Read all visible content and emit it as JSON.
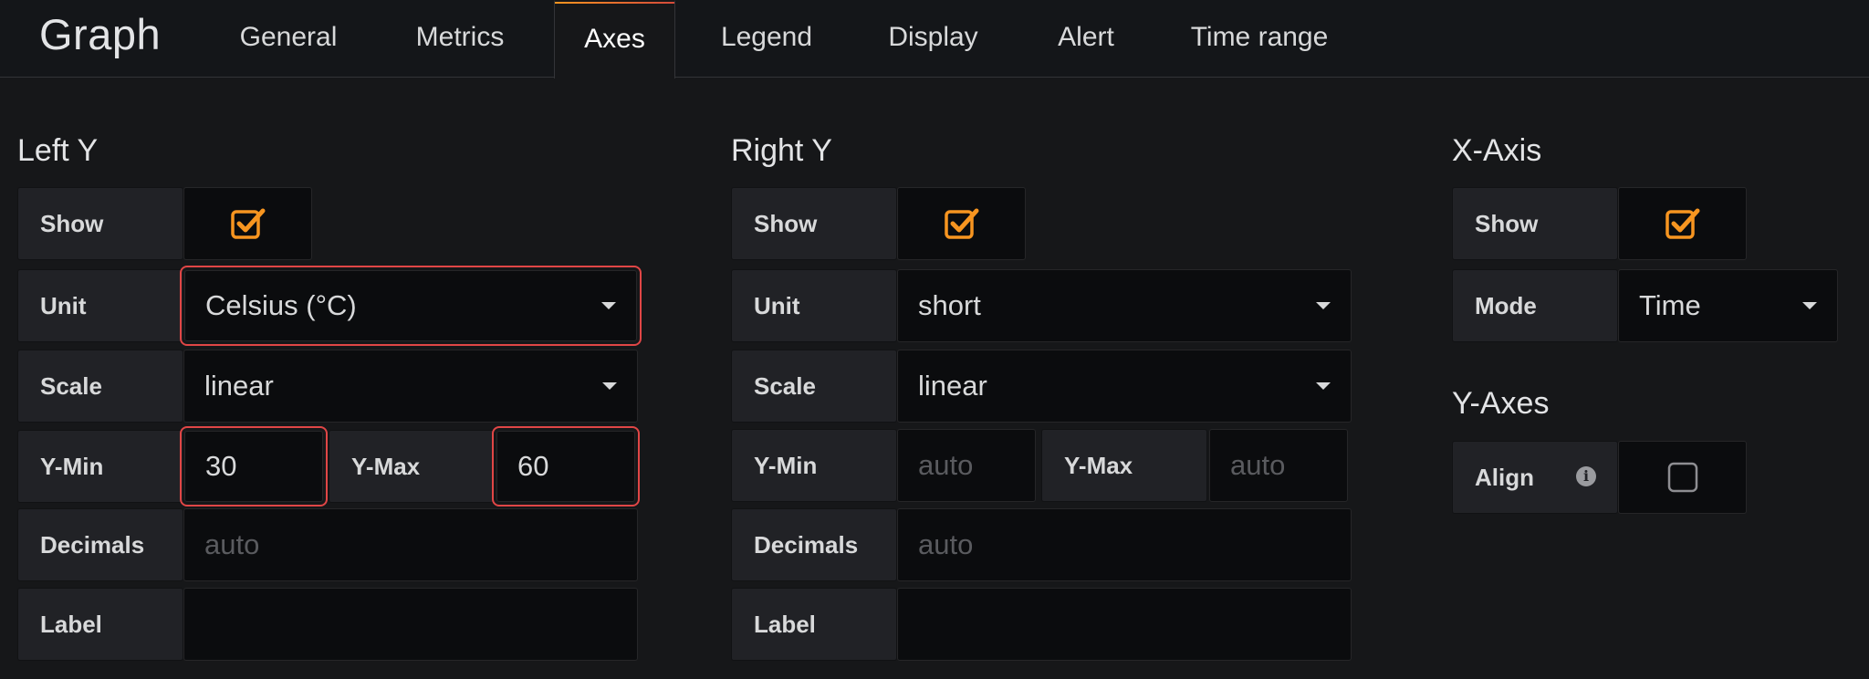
{
  "header": {
    "title": "Graph",
    "tabs": [
      "General",
      "Metrics",
      "Axes",
      "Legend",
      "Display",
      "Alert",
      "Time range"
    ],
    "active_tab": "Axes"
  },
  "left_y": {
    "title": "Left Y",
    "show_label": "Show",
    "show_checked": true,
    "unit_label": "Unit",
    "unit_value": "Celsius (°C)",
    "scale_label": "Scale",
    "scale_value": "linear",
    "ymin_label": "Y-Min",
    "ymin_value": "30",
    "ymax_label": "Y-Max",
    "ymax_value": "60",
    "decimals_label": "Decimals",
    "decimals_placeholder": "auto",
    "label_label": "Label",
    "label_value": ""
  },
  "right_y": {
    "title": "Right Y",
    "show_label": "Show",
    "show_checked": true,
    "unit_label": "Unit",
    "unit_value": "short",
    "scale_label": "Scale",
    "scale_value": "linear",
    "ymin_label": "Y-Min",
    "ymin_placeholder": "auto",
    "ymax_label": "Y-Max",
    "ymax_placeholder": "auto",
    "decimals_label": "Decimals",
    "decimals_placeholder": "auto",
    "label_label": "Label",
    "label_value": ""
  },
  "x_axis": {
    "title": "X-Axis",
    "show_label": "Show",
    "show_checked": true,
    "mode_label": "Mode",
    "mode_value": "Time"
  },
  "y_axes": {
    "title": "Y-Axes",
    "align_label": "Align",
    "align_checked": false
  },
  "colors": {
    "accent": "#f79520",
    "highlight_border": "#e04646",
    "background": "#161719",
    "field_bg": "#0b0c0e",
    "label_bg": "#212226"
  },
  "icons": {
    "checked": "checkbox-checked-icon",
    "unchecked": "checkbox-unchecked-icon",
    "caret": "caret-down-icon",
    "info": "info-icon"
  }
}
